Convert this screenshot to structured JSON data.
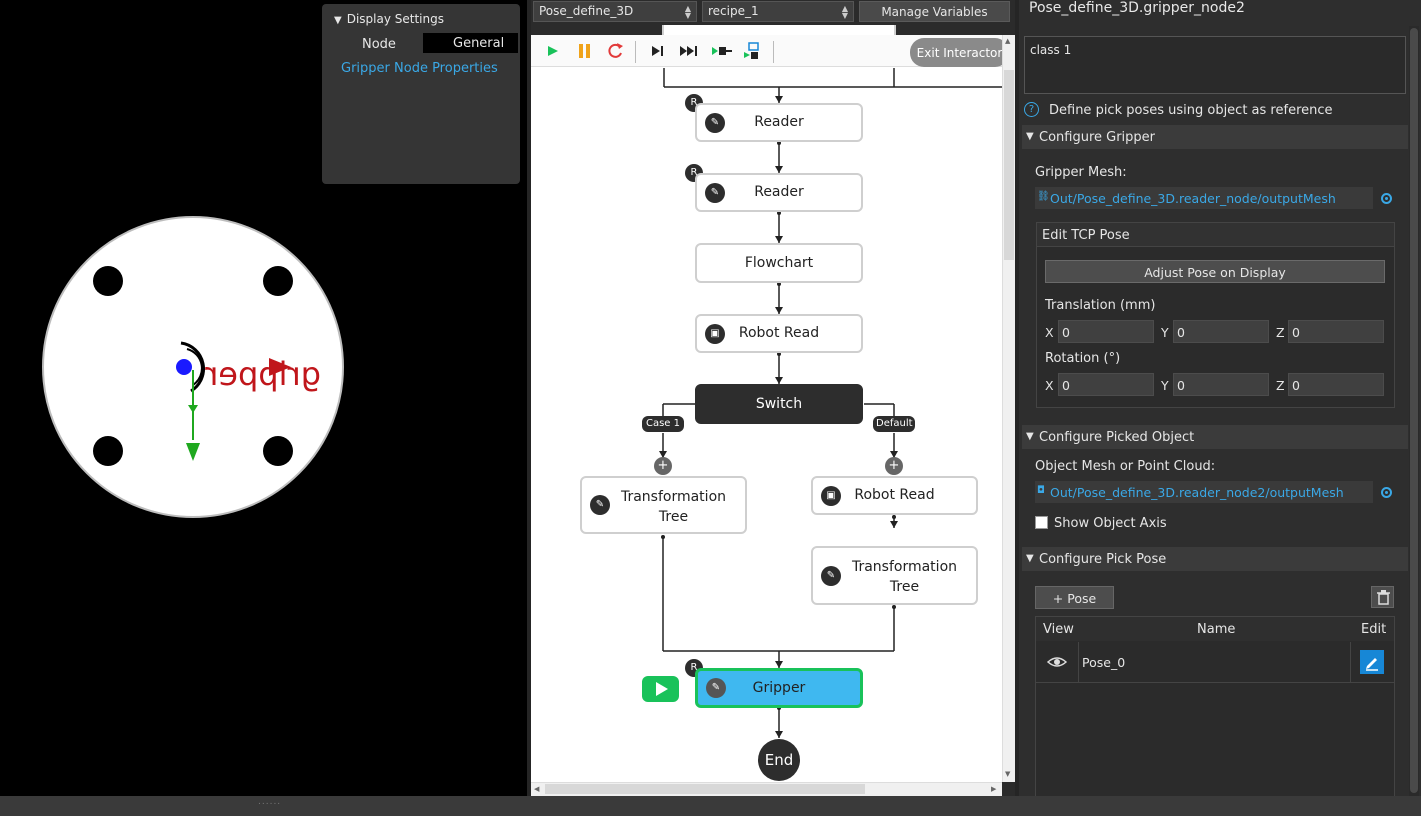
{
  "viewport": {
    "display_settings": {
      "title": "Display Settings",
      "node_label": "Node",
      "node_value": "General",
      "link": "Gripper Node Properties"
    },
    "gripper_text": "gripper"
  },
  "toolbar": {
    "project": "Pose_define_3D",
    "recipe": "recipe_1",
    "manage_variables": "Manage Variables",
    "exit_interactor": "Exit Interactor"
  },
  "flowchart": {
    "nodes": [
      {
        "label": "Reader",
        "icon": "wrench-icon",
        "badge": "R"
      },
      {
        "label": "Reader",
        "icon": "wrench-icon",
        "badge": "R"
      },
      {
        "label": "Flowchart"
      },
      {
        "label": "Robot Read",
        "icon": "robot-icon"
      },
      {
        "label": "Switch"
      },
      {
        "label": "Transformation Tree",
        "line1": "Transformation",
        "line2": "Tree",
        "icon": "wrench-icon"
      },
      {
        "label": "Robot Read",
        "icon": "robot-icon"
      },
      {
        "label": "Transformation Tree",
        "line1": "Transformation",
        "line2": "Tree",
        "icon": "wrench-icon"
      },
      {
        "label": "Gripper",
        "icon": "wrench-icon",
        "badge": "R",
        "active": true
      },
      {
        "label": "End"
      }
    ],
    "case_tags": [
      "Case 1",
      "Default"
    ],
    "plus": "+",
    "colors": {
      "active_node": "#3fb8f0",
      "active_border": "#19c25a",
      "run_button": "#19c25a"
    }
  },
  "properties": {
    "title": "Pose_define_3D.gripper_node2",
    "class_text": "class 1",
    "help_icon": "?",
    "help_text": "Define pick poses using object as reference",
    "sections": {
      "gripper": "Configure Gripper",
      "picked_object": "Configure Picked Object",
      "pick_pose": "Configure Pick Pose"
    },
    "gripper_mesh_label": "Gripper Mesh:",
    "gripper_mesh_value": "Out/Pose_define_3D.reader_node/outputMesh",
    "edit_tcp_title": "Edit TCP Pose",
    "adjust_pose_button": "Adjust Pose on Display",
    "translation_label": "Translation (mm)",
    "rotation_label": "Rotation (°)",
    "axes": [
      "X",
      "Y",
      "Z"
    ],
    "translation": [
      "0",
      "0",
      "0"
    ],
    "rotation": [
      "0",
      "0",
      "0"
    ],
    "object_mesh_label": "Object Mesh or Point Cloud:",
    "object_mesh_value": "Out/Pose_define_3D.reader_node2/outputMesh",
    "show_object_axis": "Show Object Axis",
    "add_pose_button": "+ Pose",
    "table": {
      "headers": [
        "View",
        "Name",
        "Edit"
      ],
      "rows": [
        {
          "name": "Pose_0"
        }
      ]
    },
    "accent_color": "#3aa8e6"
  }
}
